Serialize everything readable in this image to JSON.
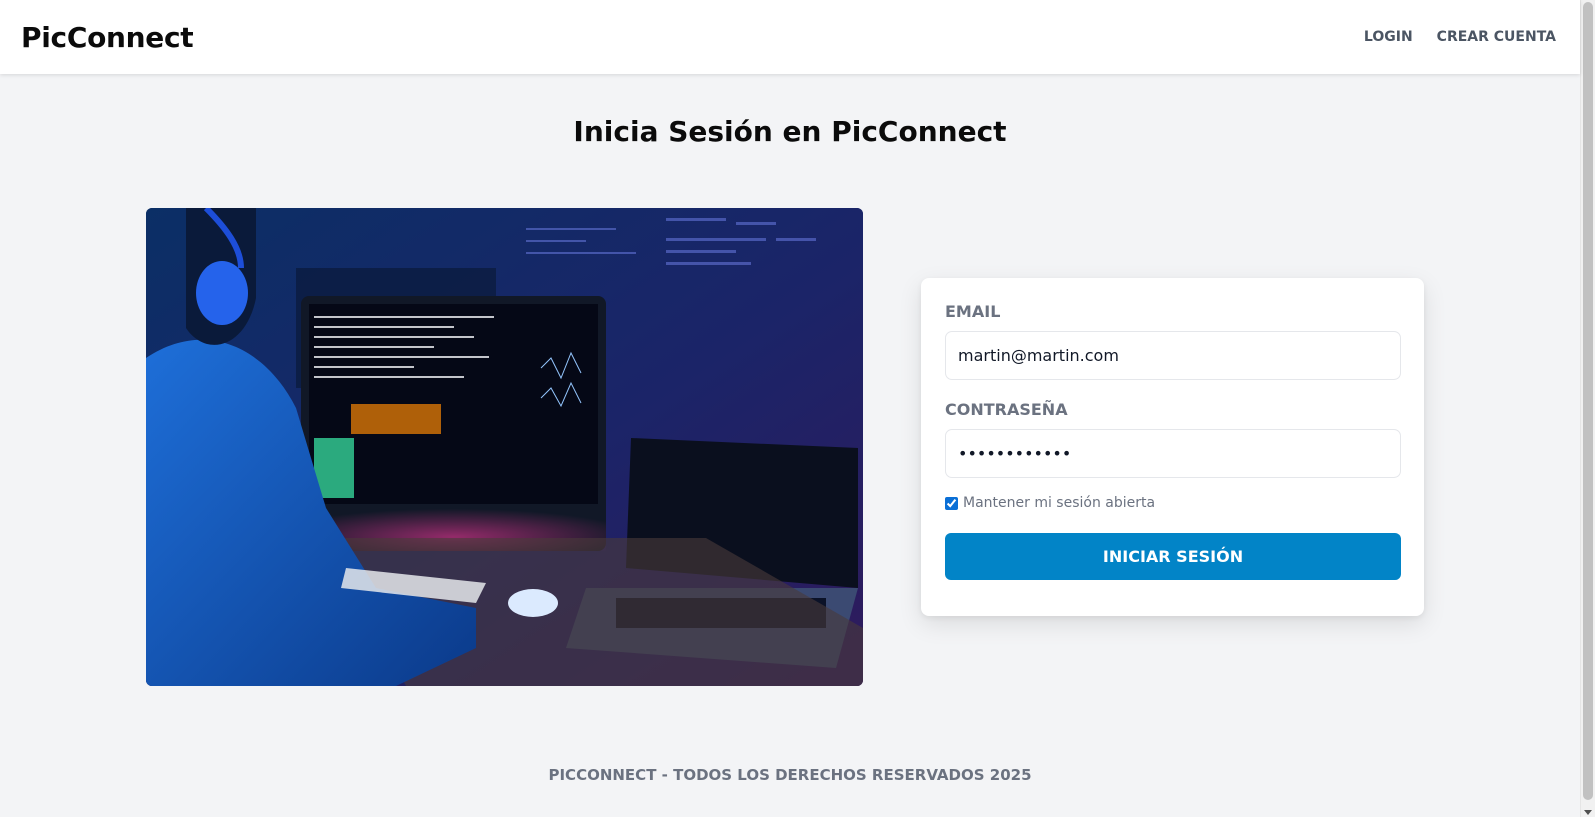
{
  "header": {
    "logo": "PicConnect",
    "nav": [
      {
        "label": "LOGIN"
      },
      {
        "label": "CREAR CUENTA"
      }
    ]
  },
  "main": {
    "title": "Inicia Sesión en PicConnect",
    "hero_image": {
      "icon": "developer-at-computer-photo"
    },
    "form": {
      "email_label": "EMAIL",
      "email_value": "martin@martin.com",
      "password_label": "CONTRASEÑA",
      "password_value": "••••••••••••",
      "remember_label": "Mantener mi sesión abierta",
      "remember_checked": true,
      "submit_label": "INICIAR SESIÓN"
    }
  },
  "footer": {
    "text": "PICCONNECT - TODOS LOS DERECHOS RESERVADOS 2025"
  },
  "colors": {
    "accent": "#0284c7",
    "background": "#f3f4f6",
    "muted_text": "#6b7280"
  }
}
